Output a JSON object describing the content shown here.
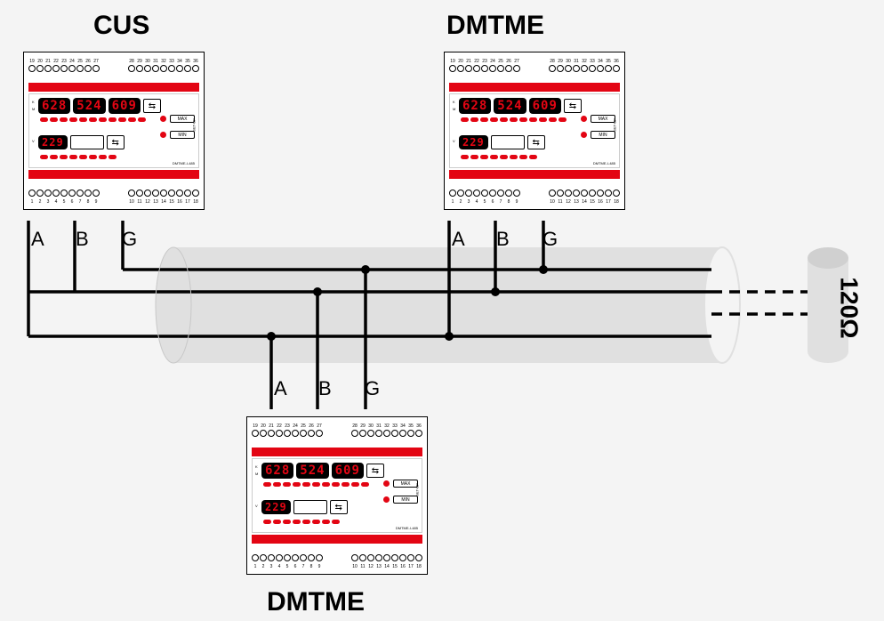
{
  "labels": {
    "dev1": "CUS",
    "dev2": "DMTME",
    "dev3": "DMTME",
    "terminator": "120Ω"
  },
  "wire": {
    "a": "A",
    "b": "B",
    "g": "G"
  },
  "disp": {
    "v1": "628",
    "v2": "524",
    "v3": "609",
    "v4": "229"
  },
  "btn": {
    "max": "MAX",
    "min": "MIN",
    "setup": "SET-UP",
    "nav": "⇆",
    "model": "DMTME-I-485"
  },
  "terminals": {
    "top_left": [
      "19",
      "20",
      "21",
      "22",
      "23",
      "24",
      "25",
      "26",
      "27"
    ],
    "top_right": [
      "28",
      "29",
      "30",
      "31",
      "32",
      "33",
      "34",
      "35",
      "36"
    ],
    "bot_left": [
      "1",
      "2",
      "3",
      "4",
      "5",
      "6",
      "7",
      "8",
      "9"
    ],
    "bot_right": [
      "10",
      "11",
      "12",
      "13",
      "14",
      "15",
      "16",
      "17",
      "18"
    ]
  },
  "side_labels": {
    "k": "K",
    "m": "M",
    "v": "V"
  }
}
